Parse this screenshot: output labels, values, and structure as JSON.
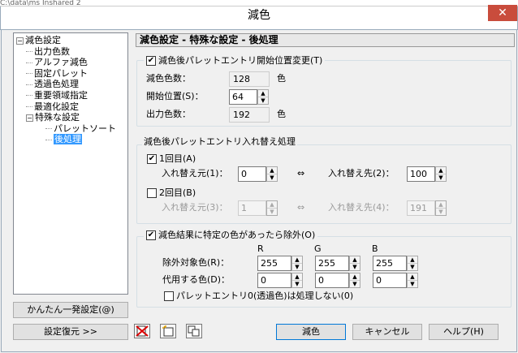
{
  "window": {
    "title": "減色",
    "close_label": "✕",
    "background_fragment": "C:\\data\\ms  Inshared  2"
  },
  "tree": {
    "items": [
      {
        "label": "減色設定",
        "level": 0,
        "expanded": true
      },
      {
        "label": "出力色数",
        "level": 1
      },
      {
        "label": "アルファ減色",
        "level": 1
      },
      {
        "label": "固定パレット",
        "level": 1
      },
      {
        "label": "透過色処理",
        "level": 1
      },
      {
        "label": "重要領域指定",
        "level": 1
      },
      {
        "label": "最適化設定",
        "level": 1
      },
      {
        "label": "特殊な設定",
        "level": 1,
        "expanded": true
      },
      {
        "label": "パレットソート",
        "level": 2
      },
      {
        "label": "後処理",
        "level": 2,
        "selected": true
      }
    ]
  },
  "buttons": {
    "quick": "かんたん一発設定(@)",
    "restore": "設定復元 >>",
    "ok": "減色",
    "cancel": "キャンセル",
    "help": "ヘルプ(H)"
  },
  "header": "減色設定 - 特殊な設定 - 後処理",
  "group1": {
    "checkbox": "減色後パレットエントリ開始位置変更(T)",
    "checked": true,
    "reduce_label": "減色色数：",
    "reduce_value": "128",
    "reduce_unit": "色",
    "start_label": "開始位置(S)：",
    "start_value": "64",
    "output_label": "出力色数：",
    "output_value": "192",
    "output_unit": "色"
  },
  "group2": {
    "title": "減色後パレットエントリ入れ替え処理",
    "first": {
      "checkbox": "1回目(A)",
      "checked": true,
      "src_label": "入れ替え元(1)：",
      "src_value": "0",
      "arrow": "⇔",
      "dst_label": "入れ替え先(2)：",
      "dst_value": "100"
    },
    "second": {
      "checkbox": "2回目(B)",
      "checked": false,
      "src_label": "入れ替え元(3)：",
      "src_value": "1",
      "arrow": "⇔",
      "dst_label": "入れ替え先(4)：",
      "dst_value": "191"
    }
  },
  "group3": {
    "checkbox": "減色結果に特定の色があったら除外(O)",
    "checked": true,
    "col_r": "R",
    "col_g": "G",
    "col_b": "B",
    "exclude_label": "除外対象色(R)：",
    "exclude": [
      "255",
      "255",
      "255"
    ],
    "replace_label": "代用する色(D)：",
    "replace": [
      "0",
      "0",
      "0"
    ],
    "palette0": "パレットエントリ0(透過色)は処理しない(0)",
    "palette0_checked": false
  }
}
